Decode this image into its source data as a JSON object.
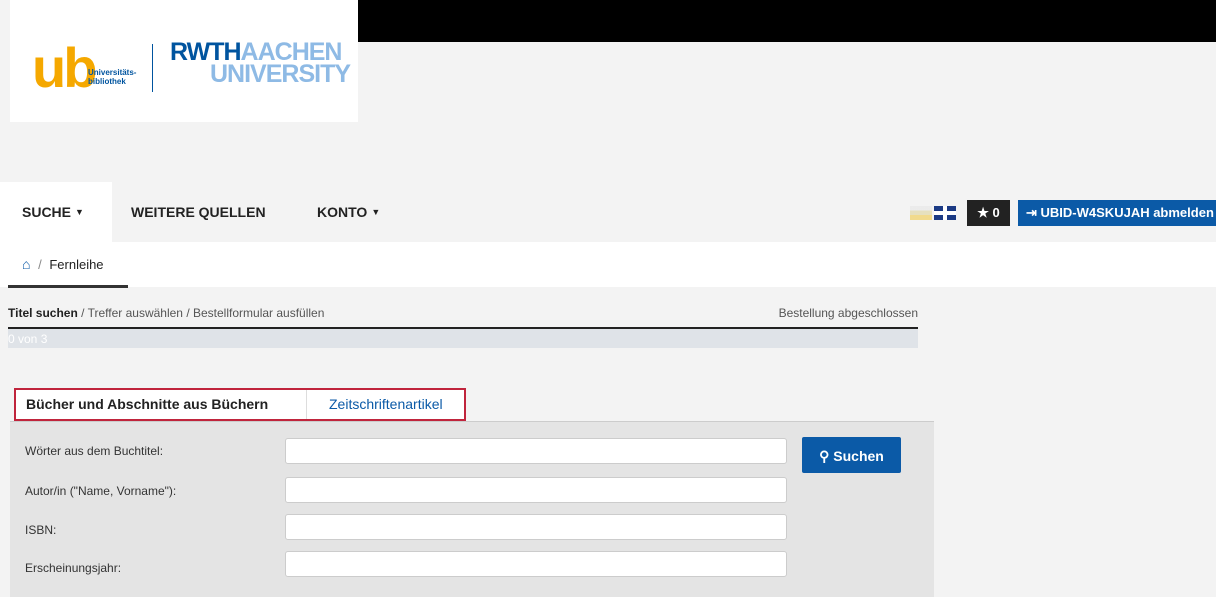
{
  "logo": {
    "ub": "ub",
    "ub_text_1": "Universitäts-",
    "ub_text_2": "bibliothek",
    "rwth": "RWTH",
    "aachen": "AACHEN",
    "university": "UNIVERSITY"
  },
  "nav": {
    "items": [
      {
        "label": "SUCHE",
        "dropdown": true
      },
      {
        "label": "WEITERE QUELLEN",
        "dropdown": false
      },
      {
        "label": "KONTO",
        "dropdown": true
      }
    ],
    "favorites_count": "0",
    "logout_label": "UBID-W4SKUJAH abmelden"
  },
  "breadcrumb": {
    "current": "Fernleihe"
  },
  "steps": {
    "step1": "Titel suchen",
    "step2": "Treffer auswählen",
    "step3": "Bestellformular ausfüllen",
    "step4": "Bestellung abgeschlossen",
    "progress_text": "0 von 3"
  },
  "tabs": {
    "books": "Bücher und Abschnitte aus Büchern",
    "articles": "Zeitschriftenartikel"
  },
  "form": {
    "title_label": "Wörter aus dem Buchtitel:",
    "author_label": "Autor/in (\"Name, Vorname\"):",
    "isbn_label": "ISBN:",
    "year_label": "Erscheinungsjahr:",
    "search_label": "Suchen"
  },
  "colors": {
    "primary": "#0b5aa7",
    "highlight": "#c0243c",
    "logo_orange": "#f5a800"
  }
}
